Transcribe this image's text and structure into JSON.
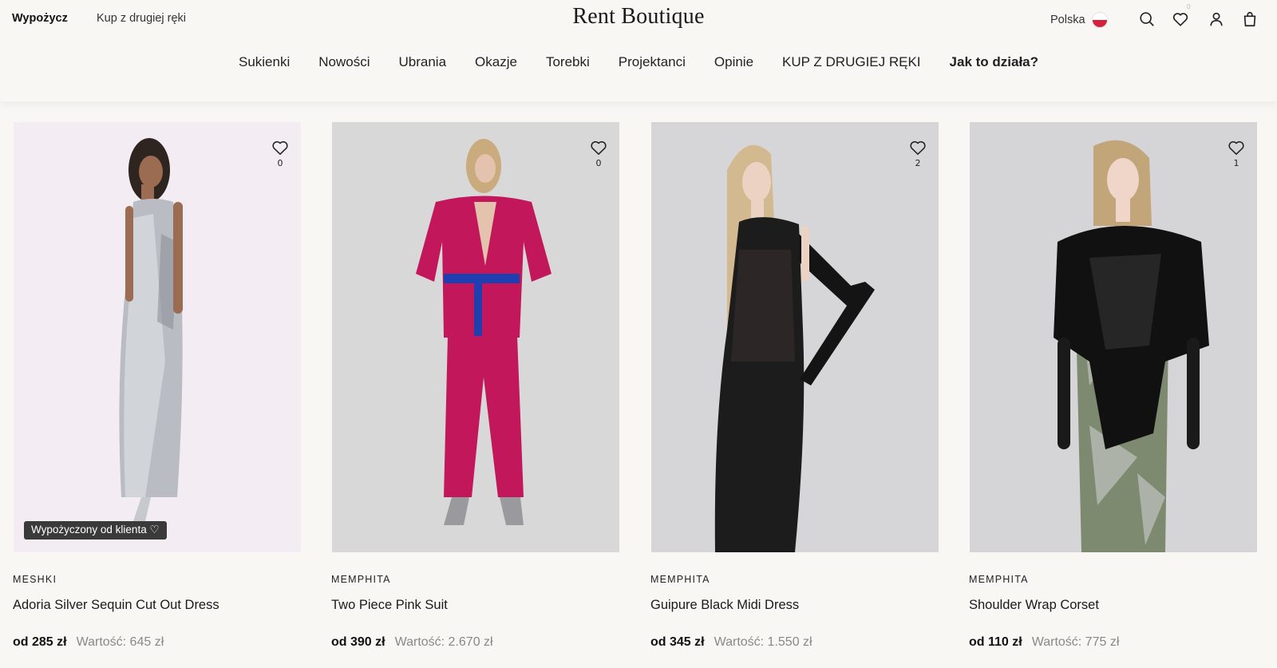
{
  "header": {
    "mode_rent": "Wypożycz",
    "mode_resale": "Kup z drugiej ręki",
    "logo": "Rent Boutique",
    "country": "Polska",
    "wishlist_count": "0"
  },
  "nav": {
    "items": [
      "Sukienki",
      "Nowości",
      "Ubrania",
      "Okazje",
      "Torebki",
      "Projektanci",
      "Opinie",
      "KUP Z DRUGIEJ RĘKI",
      "Jak to działa?"
    ]
  },
  "products": [
    {
      "brand": "MESHKI",
      "name": "Adoria Silver Sequin Cut Out Dress",
      "price": "od 285 zł",
      "value": "Wartość: 645 zł",
      "favorites": "0",
      "badge": "Wypożyczony od klienta ♡",
      "bg": "#f4ecf3"
    },
    {
      "brand": "MEMPHITA",
      "name": "Two Piece Pink Suit",
      "price": "od 390 zł",
      "value": "Wartość: 2.670 zł",
      "favorites": "0",
      "bg": "#d8d8d9"
    },
    {
      "brand": "MEMPHITA",
      "name": "Guipure Black Midi Dress",
      "price": "od 345 zł",
      "value": "Wartość: 1.550 zł",
      "favorites": "2",
      "bg": "#d6d6d8"
    },
    {
      "brand": "MEMPHITA",
      "name": "Shoulder Wrap Corset",
      "price": "od 110 zł",
      "value": "Wartość: 775 zł",
      "favorites": "1",
      "bg": "#d5d5d7"
    }
  ]
}
